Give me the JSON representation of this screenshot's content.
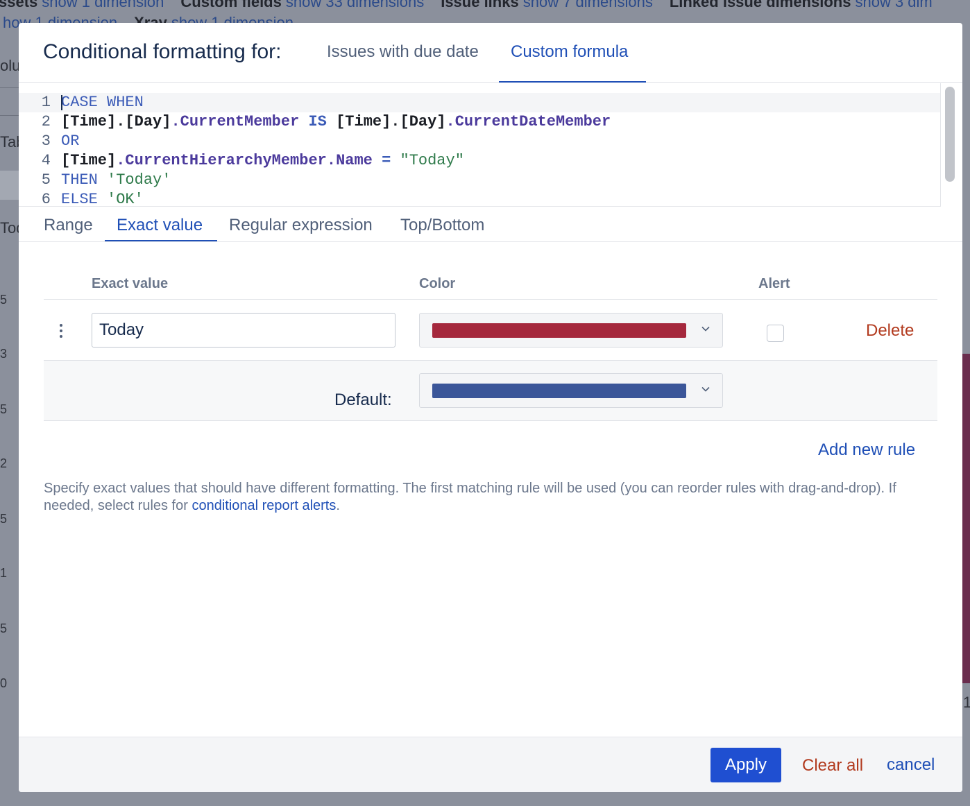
{
  "background": {
    "top_line1": [
      {
        "label": "ssets",
        "link": "show 1 dimension"
      },
      {
        "label": "Custom fields",
        "link": "show 33 dimensions"
      },
      {
        "label": "Issue links",
        "link": "show 7 dimensions"
      },
      {
        "label": "Linked issue dimensions",
        "link": "show 3 dim"
      }
    ],
    "top_line2": [
      {
        "label": "",
        "link": "how 1 dimension"
      },
      {
        "label": "Xray",
        "link": "show 1 dimension"
      }
    ],
    "side_texts": [
      "olu",
      "Tab",
      "Tod"
    ],
    "axis_ticks": [
      "5",
      "3",
      "5",
      "2",
      "5",
      "1",
      "5",
      "0"
    ],
    "right_edge_text": "1"
  },
  "modal": {
    "title": "Conditional formatting for:",
    "header_tabs": [
      {
        "label": "Issues with due date",
        "active": false
      },
      {
        "label": "Custom formula",
        "active": true
      }
    ],
    "code_lines": [
      {
        "num": "1",
        "tokens": [
          [
            "kw",
            "CASE WHEN"
          ]
        ]
      },
      {
        "num": "2",
        "tokens": [
          [
            "id",
            "[Time].[Day]"
          ],
          [
            "fn",
            ".CurrentMember"
          ],
          [
            "id",
            " "
          ],
          [
            "op",
            "IS"
          ],
          [
            "id",
            " [Time].[Day]"
          ],
          [
            "fn",
            ".CurrentDateMember"
          ]
        ]
      },
      {
        "num": "3",
        "tokens": [
          [
            "kw",
            "OR"
          ]
        ]
      },
      {
        "num": "4",
        "tokens": [
          [
            "id",
            "[Time]"
          ],
          [
            "fn",
            ".CurrentHierarchyMember.Name"
          ],
          [
            "id",
            " "
          ],
          [
            "op",
            "="
          ],
          [
            "id",
            " "
          ],
          [
            "str",
            "\"Today\""
          ]
        ]
      },
      {
        "num": "5",
        "tokens": [
          [
            "kw",
            "THEN"
          ],
          [
            "id",
            " "
          ],
          [
            "str",
            "'Today'"
          ]
        ]
      },
      {
        "num": "6",
        "tokens": [
          [
            "kw",
            "ELSE"
          ],
          [
            "id",
            " "
          ],
          [
            "str",
            "'OK'"
          ]
        ]
      }
    ],
    "sub_tabs": [
      {
        "label": "Range",
        "active": false
      },
      {
        "label": "Exact value",
        "active": true
      },
      {
        "label": "Regular expression",
        "active": false
      },
      {
        "label": "Top/Bottom",
        "active": false
      }
    ],
    "table": {
      "col_exact": "Exact value",
      "col_color": "Color",
      "col_alert": "Alert",
      "rule": {
        "value": "Today",
        "color": "#a5283d",
        "alert_checked": false,
        "delete_label": "Delete"
      },
      "default_label": "Default:",
      "default_color": "#3b5699"
    },
    "add_rule_label": "Add new rule",
    "help_text": "Specify exact values that should have different formatting. The first matching rule will be used (you can reorder rules with drag-and-drop). If needed, select rules for ",
    "help_link": "conditional report alerts",
    "help_end": ".",
    "footer": {
      "apply_label": "Apply",
      "clear_label": "Clear all",
      "cancel_label": "cancel"
    }
  }
}
